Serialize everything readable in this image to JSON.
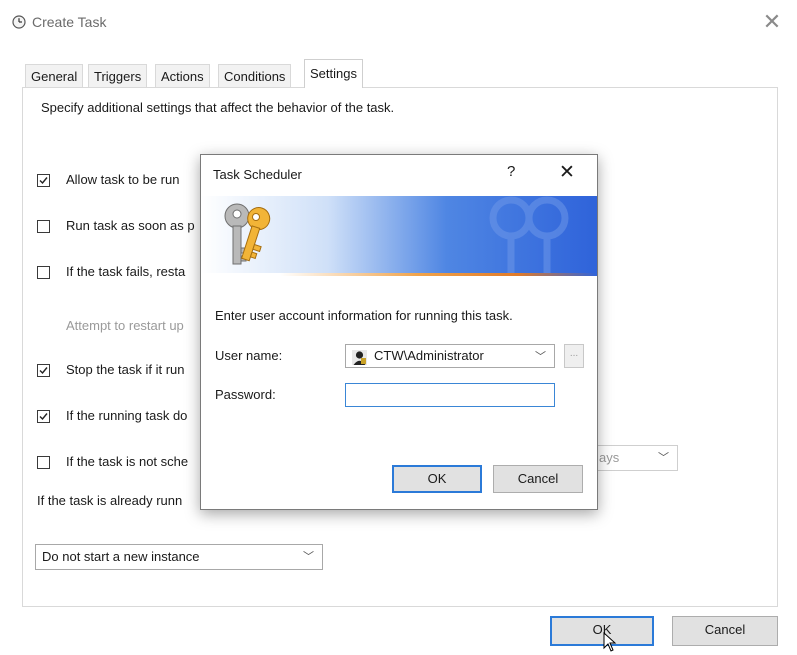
{
  "window": {
    "title": "Create Task",
    "close_glyph": "✕"
  },
  "tabs": [
    {
      "label": "General"
    },
    {
      "label": "Triggers"
    },
    {
      "label": "Actions"
    },
    {
      "label": "Conditions"
    },
    {
      "label": "Settings",
      "active": true
    }
  ],
  "settings": {
    "description": "Specify additional settings that affect the behavior of the task.",
    "options": [
      {
        "label": "Allow task to be run",
        "checked": true
      },
      {
        "label": "Run task as soon as p",
        "checked": false
      },
      {
        "label": "If the task fails, resta",
        "checked": false
      },
      {
        "label": "Attempt to restart up",
        "dimmed": true
      },
      {
        "label": "Stop the task if it run",
        "checked": true
      },
      {
        "label": "If the running task do",
        "checked": true
      },
      {
        "label": "If the task is not sche",
        "checked": false
      }
    ],
    "delete_after_value": "ays",
    "running_rule_label": "If the task is already runn",
    "instance_policy_value": "Do not start a new instance"
  },
  "footer": {
    "ok_label": "OK",
    "cancel_label": "Cancel"
  },
  "dialog": {
    "title": "Task Scheduler",
    "help_glyph": "?",
    "close_glyph": "✕",
    "prompt": "Enter user account information for running this task.",
    "user_label": "User name:",
    "user_value": "CTW\\Administrator",
    "password_label": "Password:",
    "password_value": "",
    "browse_label": "...",
    "ok_label": "OK",
    "cancel_label": "Cancel"
  },
  "colors": {
    "accent_blue": "#2b7ad8",
    "banner_blue": "#2f63da",
    "banner_orange": "#e07b2a"
  }
}
